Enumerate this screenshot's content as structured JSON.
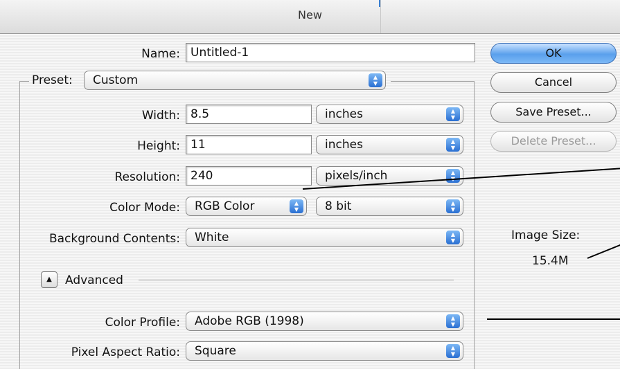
{
  "window": {
    "title": "New"
  },
  "form": {
    "name_label": "Name:",
    "name_value": "Untitled-1",
    "preset_label": "Preset:",
    "preset_value": "Custom",
    "width_label": "Width:",
    "width_value": "8.5",
    "width_unit": "inches",
    "height_label": "Height:",
    "height_value": "11",
    "height_unit": "inches",
    "resolution_label": "Resolution:",
    "resolution_value": "240",
    "resolution_unit": "pixels/inch",
    "color_mode_label": "Color Mode:",
    "color_mode_value": "RGB Color",
    "bit_depth_value": "8 bit",
    "background_label": "Background Contents:",
    "background_value": "White",
    "advanced_label": "Advanced",
    "color_profile_label": "Color Profile:",
    "color_profile_value": "Adobe RGB (1998)",
    "pixel_aspect_label": "Pixel Aspect Ratio:",
    "pixel_aspect_value": "Square"
  },
  "buttons": {
    "ok": "OK",
    "cancel": "Cancel",
    "save_preset": "Save Preset...",
    "delete_preset": "Delete Preset..."
  },
  "image_size": {
    "label": "Image Size:",
    "value": "15.4M"
  },
  "icons": {
    "popup_arrows": "up-down-arrows-icon",
    "disclosure": "triangle-up-icon"
  },
  "colors": {
    "default_button": "#5aa0ec",
    "popup_arrows": "#2a6fd2"
  }
}
